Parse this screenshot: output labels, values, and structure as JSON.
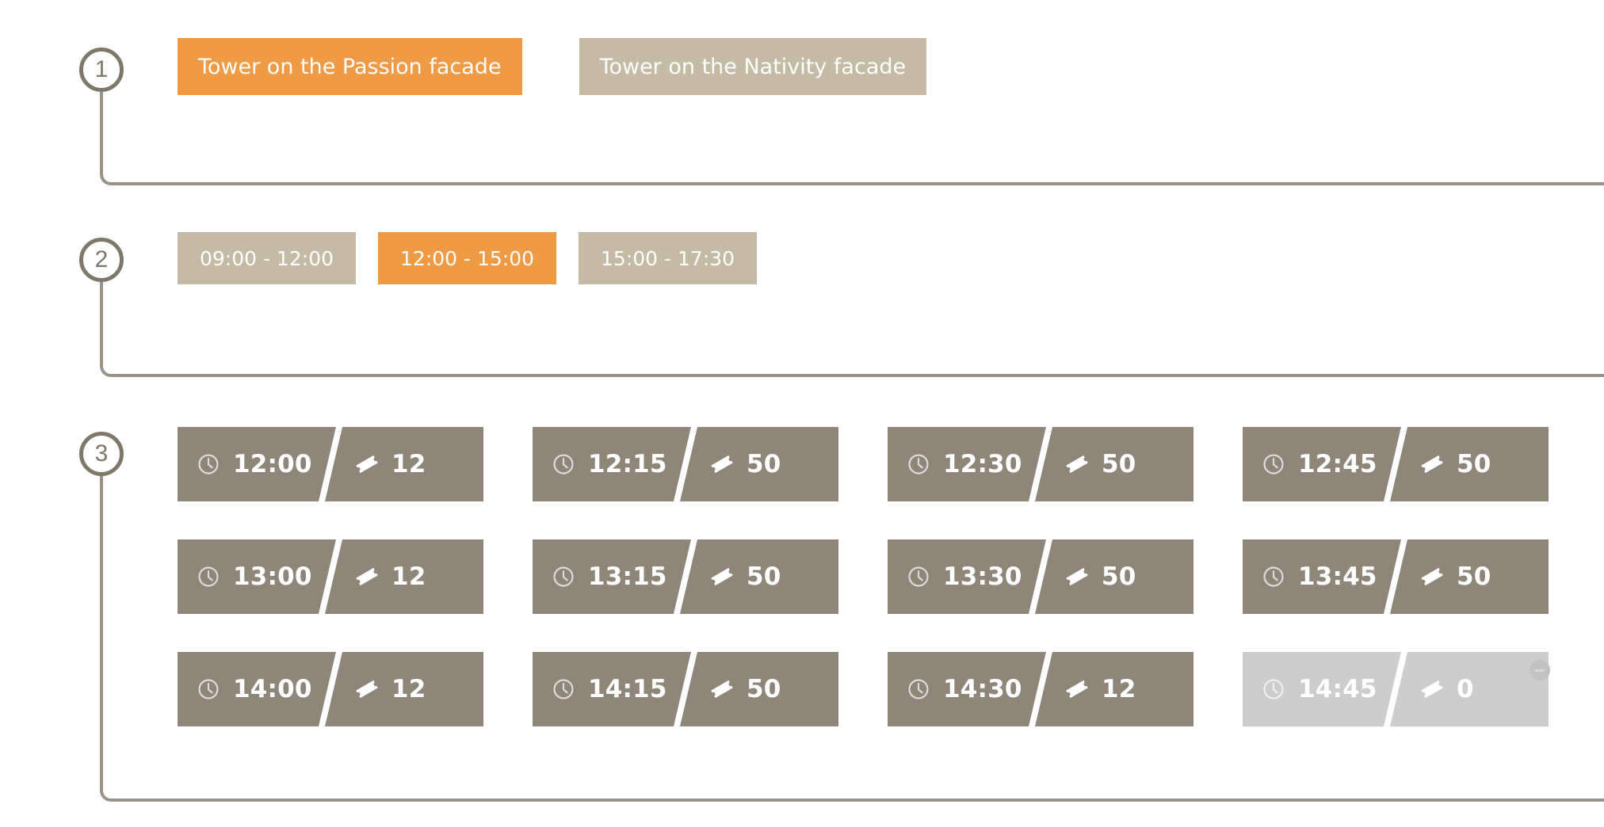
{
  "theme": {
    "accent": "#ef9a44",
    "muted": "#c5baa6",
    "tile": "#8f8679",
    "tile_disabled": "#cdcdcd",
    "marker": "#7f7767",
    "connector": "#9a9286"
  },
  "steps": [
    {
      "number": "1",
      "name": "facade-selection",
      "options": [
        {
          "label": "Tower on the Passion facade",
          "selected": true
        },
        {
          "label": "Tower on the Nativity facade",
          "selected": false
        }
      ]
    },
    {
      "number": "2",
      "name": "time-range-selection",
      "options": [
        {
          "label": "09:00 - 12:00",
          "selected": false
        },
        {
          "label": "12:00 - 15:00",
          "selected": true
        },
        {
          "label": "15:00 - 17:30",
          "selected": false
        }
      ]
    },
    {
      "number": "3",
      "name": "timeslot-selection",
      "icons": {
        "time": "clock-icon",
        "tickets": "ticket-icon",
        "unavailable": "minus-circle-icon"
      },
      "slots": [
        {
          "time": "12:00",
          "tickets": "12",
          "available": true
        },
        {
          "time": "12:15",
          "tickets": "50",
          "available": true
        },
        {
          "time": "12:30",
          "tickets": "50",
          "available": true
        },
        {
          "time": "12:45",
          "tickets": "50",
          "available": true
        },
        {
          "time": "13:00",
          "tickets": "12",
          "available": true
        },
        {
          "time": "13:15",
          "tickets": "50",
          "available": true
        },
        {
          "time": "13:30",
          "tickets": "50",
          "available": true
        },
        {
          "time": "13:45",
          "tickets": "50",
          "available": true
        },
        {
          "time": "14:00",
          "tickets": "12",
          "available": true
        },
        {
          "time": "14:15",
          "tickets": "50",
          "available": true
        },
        {
          "time": "14:30",
          "tickets": "12",
          "available": true
        },
        {
          "time": "14:45",
          "tickets": "0",
          "available": false
        }
      ]
    }
  ]
}
